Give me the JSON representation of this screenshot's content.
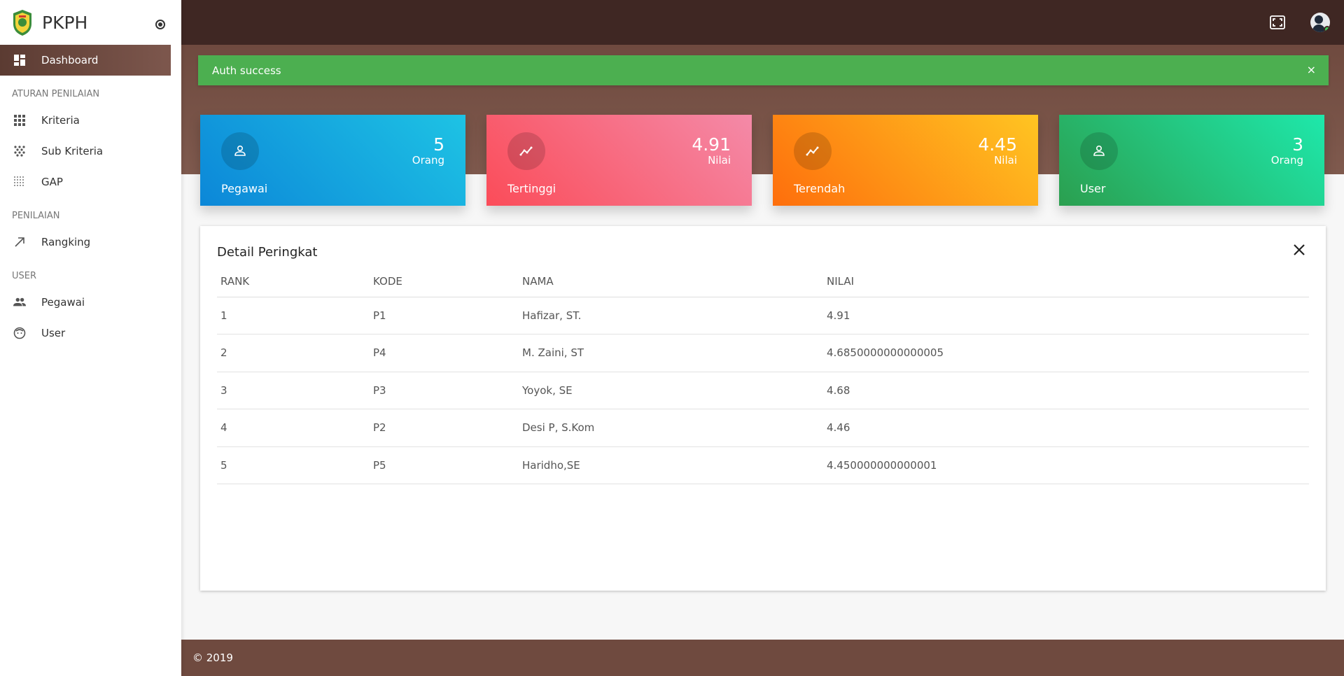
{
  "brand": {
    "title": "PKPH"
  },
  "nav": {
    "dashboard": "Dashboard",
    "section_aturan": "ATURAN PENILAIAN",
    "kriteria": "Kriteria",
    "sub_kriteria": "Sub Kriteria",
    "gap": "GAP",
    "section_penilaian": "PENILAIAN",
    "rangking": "Rangking",
    "section_user": "USER",
    "pegawai": "Pegawai",
    "user": "User"
  },
  "alert": {
    "text": "Auth success",
    "close": "×"
  },
  "cards": [
    {
      "value": "5",
      "unit": "Orang",
      "label": "Pegawai",
      "icon": "person-icon"
    },
    {
      "value": "4.91",
      "unit": "Nilai",
      "label": "Tertinggi",
      "icon": "trending-icon"
    },
    {
      "value": "4.45",
      "unit": "Nilai",
      "label": "Terendah",
      "icon": "trending-icon"
    },
    {
      "value": "3",
      "unit": "Orang",
      "label": "User",
      "icon": "person-icon"
    }
  ],
  "detail": {
    "title": "Detail Peringkat",
    "columns": [
      "RANK",
      "KODE",
      "NAMA",
      "NILAI"
    ],
    "rows": [
      [
        "1",
        "P1",
        "Hafizar, ST.",
        "4.91"
      ],
      [
        "2",
        "P4",
        "M. Zaini, ST",
        "4.6850000000000005"
      ],
      [
        "3",
        "P3",
        "Yoyok, SE",
        "4.68"
      ],
      [
        "4",
        "P2",
        "Desi P, S.Kom",
        "4.46"
      ],
      [
        "5",
        "P5",
        "Haridho,SE",
        "4.450000000000001"
      ]
    ]
  },
  "footer": {
    "text": "© 2019"
  },
  "colors": {
    "topbar": "#3f2723",
    "accent": "#6f4a3f",
    "alert": "#4caf50"
  }
}
